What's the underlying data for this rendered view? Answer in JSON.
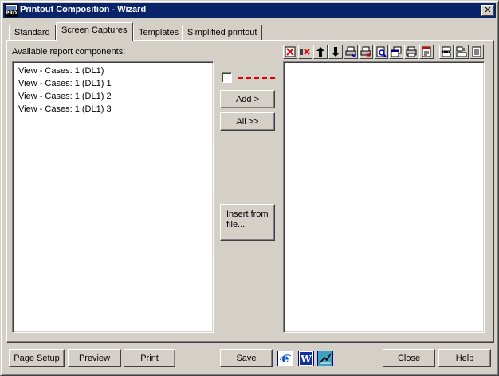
{
  "window": {
    "title": "Printout Composition - Wizard",
    "app_icon_text": "PRO",
    "close_glyph": "✕"
  },
  "tabs": [
    {
      "label": "Standard",
      "active": false
    },
    {
      "label": "Screen Captures",
      "active": true
    },
    {
      "label": "Templates",
      "active": false
    },
    {
      "label": "Simplified printout",
      "active": false
    }
  ],
  "available": {
    "label": "Available report components:",
    "items": [
      "View - Cases: 1 (DL1)",
      "View - Cases: 1 (DL1) 1",
      "View - Cases: 1 (DL1) 2",
      "View - Cases: 1 (DL1) 3"
    ]
  },
  "middle": {
    "checkbox_checked": false,
    "add_label": "Add >",
    "all_label": "All >>",
    "insert_label": "Insert from\nfile..."
  },
  "toolbar": {
    "icons": [
      "delete-icon",
      "delete-all-icon",
      "move-up-icon",
      "move-down-icon",
      "print-setup-icon",
      "print-delete-icon",
      "print-preview-icon",
      "window-icon",
      "printer-icon",
      "edit-page-icon",
      "page-break-icon",
      "page-layout-icon",
      "page-format-icon"
    ]
  },
  "selected": {
    "items": []
  },
  "footer": {
    "page_setup_label": "Page Setup",
    "preview_label": "Preview",
    "print_label": "Print",
    "save_label": "Save",
    "close_label": "Close",
    "help_label": "Help",
    "app_icons": [
      "internet-explorer-icon",
      "word-icon",
      "chart-export-icon"
    ]
  },
  "colors": {
    "titlebar": "#0a246a",
    "face": "#d4d0c8",
    "dash": "#e00000"
  }
}
